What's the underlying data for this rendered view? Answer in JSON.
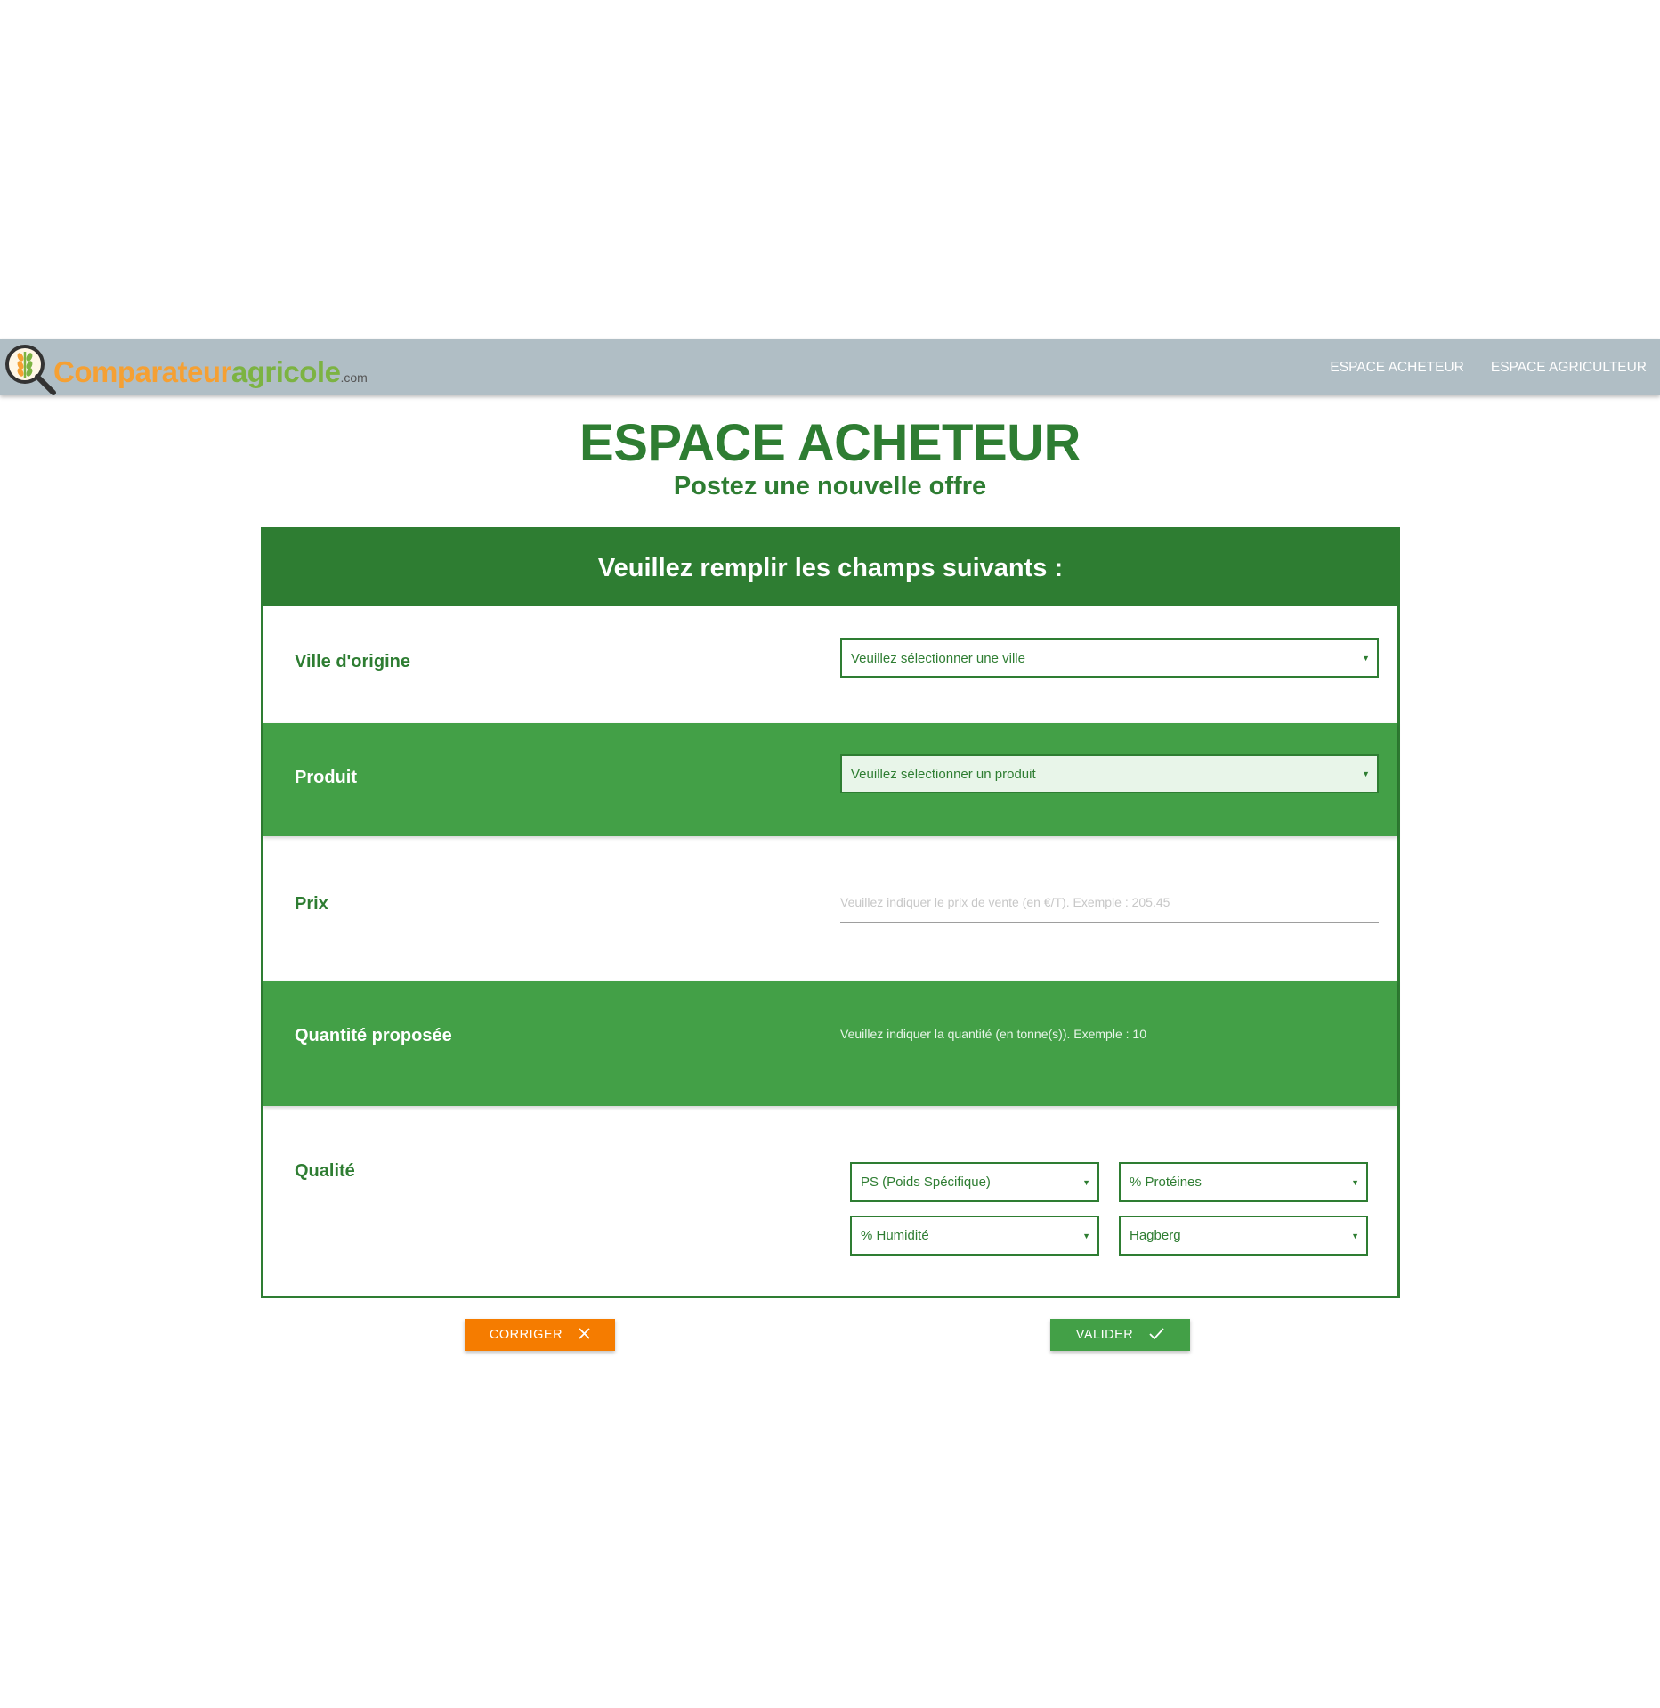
{
  "brand": {
    "name_part1": "Comparateur",
    "name_part2": "agricole",
    "name_suffix": ".com",
    "colors": {
      "orange": "#f5a033",
      "green": "#7cb342"
    }
  },
  "nav": {
    "items": [
      {
        "label": "ESPACE ACHETEUR"
      },
      {
        "label": "ESPACE AGRICULTEUR"
      }
    ]
  },
  "page": {
    "title": "ESPACE ACHETEUR",
    "subtitle": "Postez une nouvelle offre"
  },
  "form": {
    "header": "Veuillez remplir les champs suivants :",
    "ville": {
      "label": "Ville d'origine",
      "selected": "Veuillez sélectionner une ville"
    },
    "produit": {
      "label": "Produit",
      "selected": "Veuillez sélectionner un produit"
    },
    "prix": {
      "label": "Prix",
      "placeholder": "Veuillez indiquer le prix de vente (en €/T). Exemple : 205.45"
    },
    "quantite": {
      "label": "Quantité proposée",
      "placeholder": "Veuillez indiquer la quantité (en tonne(s)). Exemple : 10"
    },
    "qualite": {
      "label": "Qualité",
      "ps": "PS (Poids Spécifique)",
      "proteines": "% Protéines",
      "humidite": "% Humidité",
      "hagberg": "Hagberg"
    }
  },
  "buttons": {
    "corriger": "CORRIGER",
    "valider": "VALIDER"
  },
  "colors": {
    "primary_green": "#2e7d32",
    "row_green": "#43a047",
    "navbar": "#b0bec5",
    "orange": "#f57c00"
  }
}
